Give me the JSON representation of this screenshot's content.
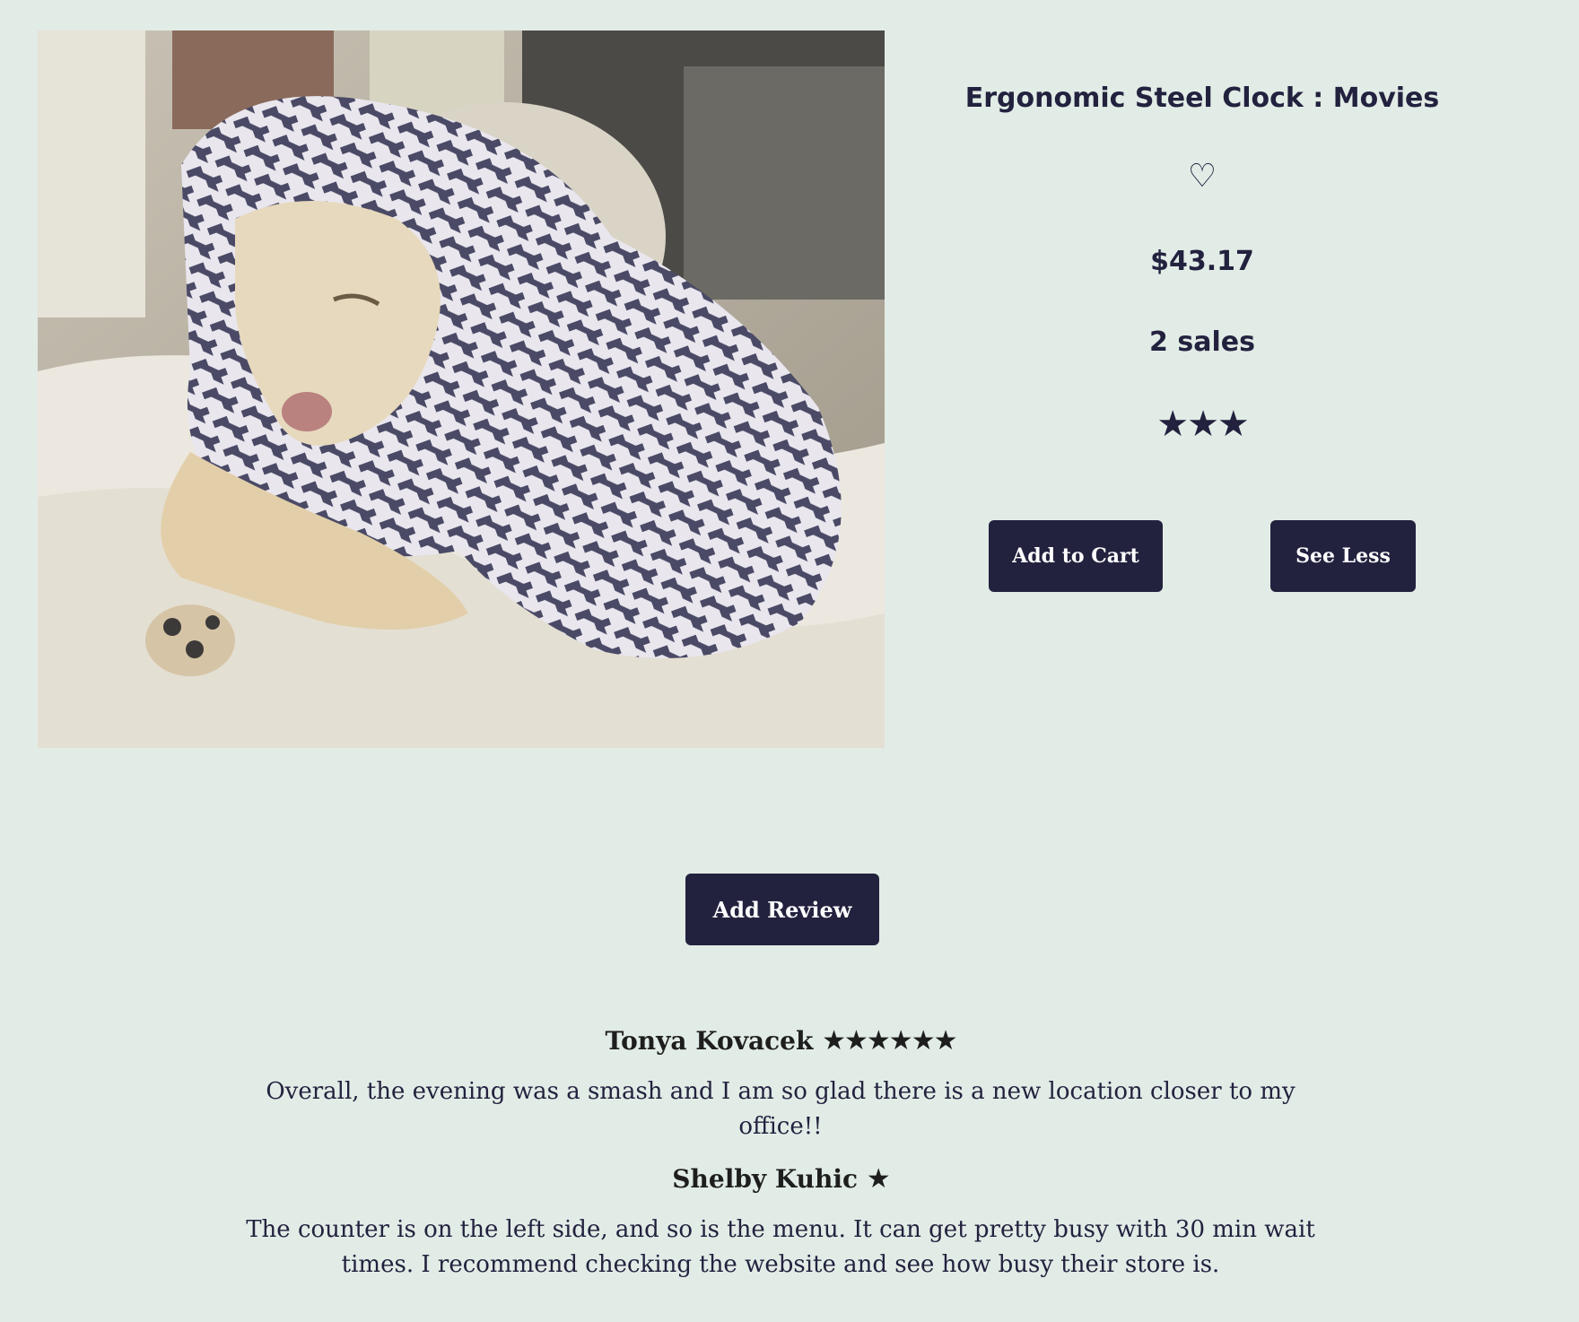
{
  "product": {
    "title": "Ergonomic Steel Clock : Movies",
    "heart_icon": "♡",
    "price": "$43.17",
    "sales": "2 sales",
    "rating_stars": "★★★",
    "image_alt": "dog wrapped in houndstooth blanket"
  },
  "actions": {
    "add_to_cart": "Add to Cart",
    "see_less": "See Less",
    "add_review": "Add Review"
  },
  "reviews": [
    {
      "author": "Tonya Kovacek",
      "stars": "★★★★★★",
      "body": "Overall, the evening was a smash and I am so glad there is a new location closer to my office!!"
    },
    {
      "author": "Shelby Kuhic",
      "stars": "★",
      "body": "The counter is on the left side, and so is the menu. It can get pretty busy with 30 min wait times. I recommend checking the website and see how busy their store is."
    }
  ],
  "colors": {
    "background": "#e2ece6",
    "primary": "#22223f",
    "button_text": "#ffffff"
  }
}
